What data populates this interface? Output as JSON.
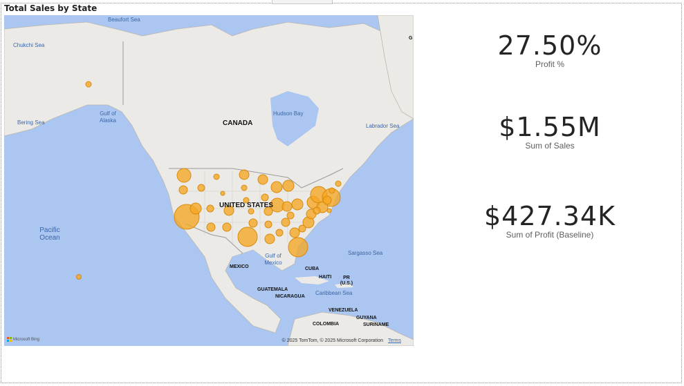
{
  "visual_title": "Total Sales by State",
  "map": {
    "water_labels": [
      "Beaufort Sea",
      "Chukchi Sea",
      "Bering Sea",
      "Gulf of Alaska",
      "Hudson Bay",
      "Labrador Sea",
      "Pacific Ocean",
      "Gulf of Mexico",
      "Sargasso Sea",
      "Caribbean Sea"
    ],
    "country_labels": [
      "CANADA",
      "UNITED STATES",
      "MEXICO",
      "CUBA",
      "HAITI",
      "PR (U.S.)",
      "GUATEMALA",
      "NICARAGUA",
      "VENEZUELA",
      "COLOMBIA",
      "GUYANA",
      "SURINAME"
    ],
    "edge_label": "G",
    "attribution": "© 2025 TomTom, © 2025 Microsoft Corporation",
    "terms": "Terms",
    "logo_text": "Microsoft Bing",
    "bubble_color": "#f5a623"
  },
  "kpis": [
    {
      "value": "27.50%",
      "caption": "Profit %"
    },
    {
      "value": "$1.55M",
      "caption": "Sum of Sales"
    },
    {
      "value": "$427.34K",
      "caption": "Sum of Profit (Baseline)"
    }
  ]
}
